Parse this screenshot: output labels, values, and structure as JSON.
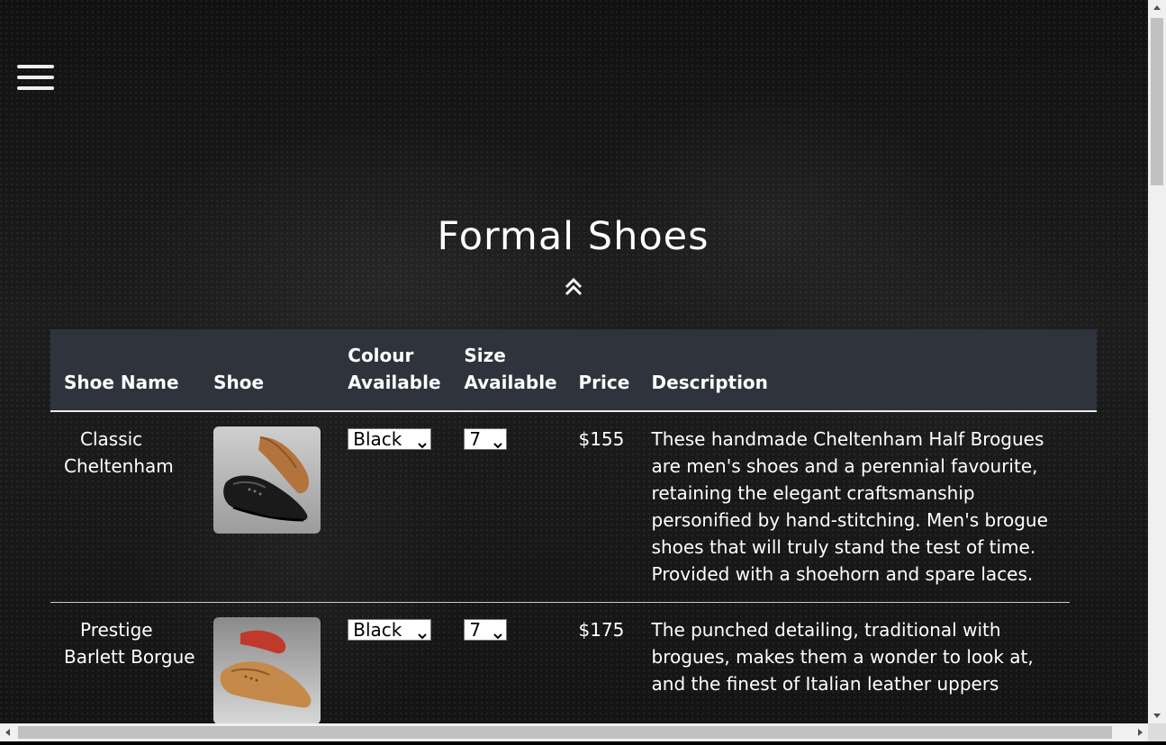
{
  "page": {
    "title": "Formal Shoes",
    "menu_icon": "hamburger-menu-icon",
    "up_icon": "double-chevron-up-icon"
  },
  "table": {
    "headers": {
      "name": "Shoe Name",
      "shoe": "Shoe",
      "colour": "Colour Available",
      "size": "Size Available",
      "price": "Price",
      "description": "Description"
    },
    "rows": [
      {
        "name_line1": "Classic",
        "name_rest": "Cheltenham",
        "image_icon": "black-brogue-shoe-image",
        "colour": "Black",
        "size": "7",
        "price": "$155",
        "description": "These handmade Cheltenham Half Brogues are men's shoes and a perennial favourite, retaining the elegant craftsmanship personified by hand-stitching. Men's brogue shoes that will truly stand the test of time. Provided with a shoehorn and spare laces."
      },
      {
        "name_line1": "Prestige",
        "name_rest": "Barlett Borgue",
        "image_icon": "tan-brogue-shoe-image",
        "colour": "Black",
        "size": "7",
        "price": "$175",
        "description": "The punched detailing, traditional with brogues, makes them a wonder to look at, and the finest of Italian leather uppers"
      }
    ]
  },
  "colors": {
    "header_bg": "#2f333b",
    "text": "#ffffff",
    "page_bg": "#111111"
  }
}
